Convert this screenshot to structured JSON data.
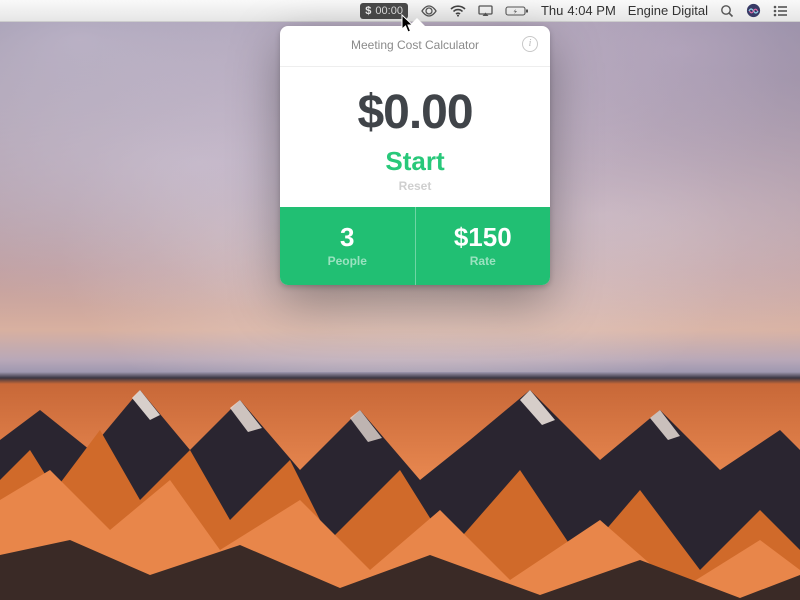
{
  "menubar": {
    "meter_prefix": "$",
    "meter_value": "00:00",
    "day": "Thu",
    "time": "4:04 PM",
    "username": "Engine Digital"
  },
  "popover": {
    "title": "Meeting Cost Calculator",
    "amount": "$0.00",
    "start_label": "Start",
    "reset_label": "Reset",
    "people_value": "3",
    "people_label": "People",
    "rate_value": "$150",
    "rate_label": "Rate"
  }
}
